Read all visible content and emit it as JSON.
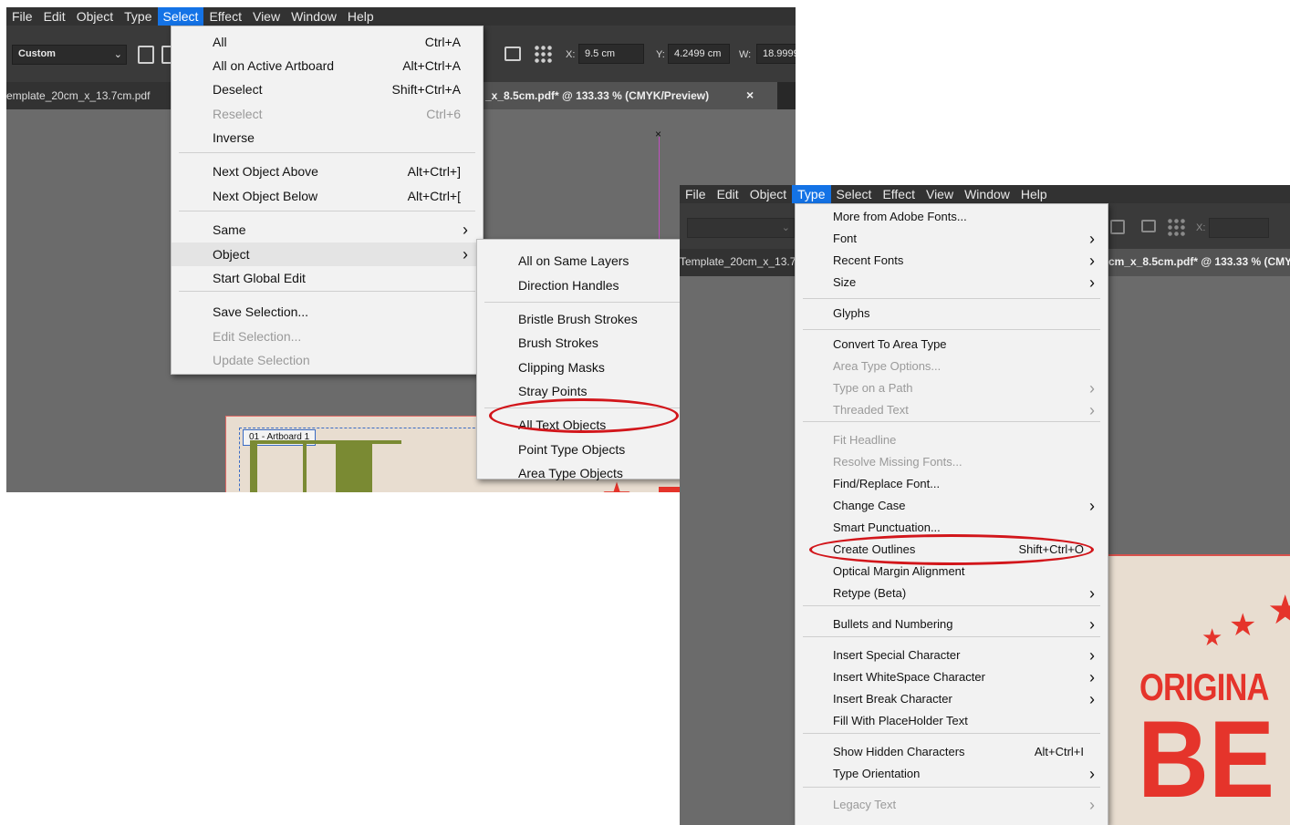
{
  "menubar_items": [
    "File",
    "Edit",
    "Object",
    "Type",
    "Select",
    "Effect",
    "View",
    "Window",
    "Help"
  ],
  "screenshot_a": {
    "active_menu": "Select",
    "toolbar": {
      "preset": "Custom",
      "x_label": "X:",
      "x_value": "9.5 cm",
      "y_label": "Y:",
      "y_value": "4.2499 cm",
      "w_label": "W:",
      "w_value": "18.9999"
    },
    "tabs": {
      "left": "emplate_20cm_x_13.7cm.pdf",
      "right": "_x_8.5cm.pdf* @ 133.33 % (CMYK/Preview)",
      "close": "×"
    },
    "artboard_label": "01 - Artboard 1",
    "select_menu": [
      {
        "label": "All",
        "shortcut": "Ctrl+A"
      },
      {
        "label": "All on Active Artboard",
        "shortcut": "Alt+Ctrl+A"
      },
      {
        "label": "Deselect",
        "shortcut": "Shift+Ctrl+A"
      },
      {
        "label": "Reselect",
        "shortcut": "Ctrl+6",
        "disabled": true
      },
      {
        "label": "Inverse",
        "shortcut": ""
      },
      {
        "label": "Next Object Above",
        "shortcut": "Alt+Ctrl+]"
      },
      {
        "label": "Next Object Below",
        "shortcut": "Alt+Ctrl+["
      },
      {
        "label": "Same",
        "shortcut": "",
        "submenu": true
      },
      {
        "label": "Object",
        "shortcut": "",
        "submenu": true,
        "highlighted": true
      },
      {
        "label": "Start Global Edit",
        "shortcut": ""
      },
      {
        "label": "Save Selection...",
        "shortcut": ""
      },
      {
        "label": "Edit Selection...",
        "shortcut": "",
        "disabled": true
      },
      {
        "label": "Update Selection",
        "shortcut": "",
        "disabled": true
      }
    ],
    "object_submenu": [
      {
        "label": "All on Same Layers"
      },
      {
        "label": "Direction Handles"
      },
      {
        "label": "Bristle Brush Strokes"
      },
      {
        "label": "Brush Strokes"
      },
      {
        "label": "Clipping Masks"
      },
      {
        "label": "Stray Points"
      },
      {
        "label": "All Text Objects",
        "circled": true
      },
      {
        "label": "Point Type Objects"
      },
      {
        "label": "Area Type Objects"
      }
    ]
  },
  "screenshot_b": {
    "active_menu": "Type",
    "toolbar_x_label": "X:",
    "tabs": {
      "left": "Template_20cm_x_13.7",
      "right": "cm_x_8.5cm.pdf* @ 133.33 % (CMY"
    },
    "artwork_text": {
      "line1": "ORIGINA",
      "line2": "BE"
    },
    "type_menu": [
      {
        "label": "More from Adobe Fonts..."
      },
      {
        "label": "Font",
        "submenu": true
      },
      {
        "label": "Recent Fonts",
        "submenu": true
      },
      {
        "label": "Size",
        "submenu": true
      },
      {
        "label": "Glyphs"
      },
      {
        "label": "Convert To Area Type"
      },
      {
        "label": "Area Type Options...",
        "disabled": true
      },
      {
        "label": "Type on a Path",
        "disabled": true,
        "submenu": true
      },
      {
        "label": "Threaded Text",
        "disabled": true,
        "submenu": true
      },
      {
        "label": "Fit Headline",
        "disabled": true
      },
      {
        "label": "Resolve Missing Fonts...",
        "disabled": true
      },
      {
        "label": "Find/Replace Font..."
      },
      {
        "label": "Change Case",
        "submenu": true
      },
      {
        "label": "Smart Punctuation..."
      },
      {
        "label": "Create Outlines",
        "shortcut": "Shift+Ctrl+O",
        "circled": true
      },
      {
        "label": "Optical Margin Alignment"
      },
      {
        "label": "Retype (Beta)",
        "submenu": true
      },
      {
        "label": "Bullets and Numbering",
        "submenu": true
      },
      {
        "label": "Insert Special Character",
        "submenu": true
      },
      {
        "label": "Insert WhiteSpace Character",
        "submenu": true
      },
      {
        "label": "Insert Break Character",
        "submenu": true
      },
      {
        "label": "Fill With PlaceHolder Text"
      },
      {
        "label": "Show Hidden Characters",
        "shortcut": "Alt+Ctrl+I"
      },
      {
        "label": "Type Orientation",
        "submenu": true
      },
      {
        "label": "Legacy Text",
        "disabled": true,
        "submenu": true
      }
    ]
  },
  "colors": {
    "menubar_bg": "#323232",
    "highlight": "#1473e6",
    "annotation_red": "#d2161b",
    "artwork_red": "#e5342b",
    "artwork_green": "#7a8a33",
    "artboard_bg": "#e8ddd0"
  }
}
